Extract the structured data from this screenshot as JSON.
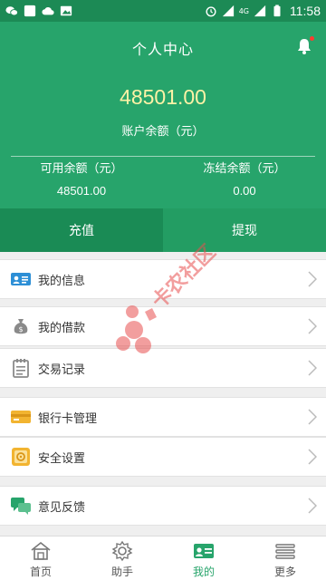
{
  "status_bar": {
    "time": "11:58",
    "network_label": "4G"
  },
  "header": {
    "title": "个人中心",
    "balance": "48501.00",
    "balance_label": "账户余额（元）",
    "available_label": "可用余额（元）",
    "available_value": "48501.00",
    "frozen_label": "冻结余额（元）",
    "frozen_value": "0.00"
  },
  "actions": {
    "recharge_label": "充值",
    "withdraw_label": "提现"
  },
  "menu": {
    "items": [
      {
        "label": "我的信息",
        "icon": "id-card-icon",
        "color": "#2d8fd6"
      },
      {
        "label": "我的借款",
        "icon": "money-bag-icon",
        "color": "#8a8a8a"
      },
      {
        "label": "交易记录",
        "icon": "notepad-icon",
        "color": "#8a8a8a"
      },
      {
        "label": "银行卡管理",
        "icon": "bank-card-icon",
        "color": "#f2b430"
      },
      {
        "label": "安全设置",
        "icon": "safe-icon",
        "color": "#f2b430"
      },
      {
        "label": "意见反馈",
        "icon": "chat-icon",
        "color": "#27a46b"
      }
    ]
  },
  "watermark_text": "卡农社区",
  "bottom_nav": {
    "tabs": [
      {
        "label": "首页",
        "icon": "home-icon"
      },
      {
        "label": "助手",
        "icon": "gear-icon"
      },
      {
        "label": "我的",
        "icon": "profile-card-icon",
        "active": true
      },
      {
        "label": "更多",
        "icon": "menu-lines-icon"
      }
    ]
  },
  "colors": {
    "brand_green": "#27a46b",
    "dark_green": "#1a8b55",
    "balance_yellow": "#fdf2a6"
  }
}
